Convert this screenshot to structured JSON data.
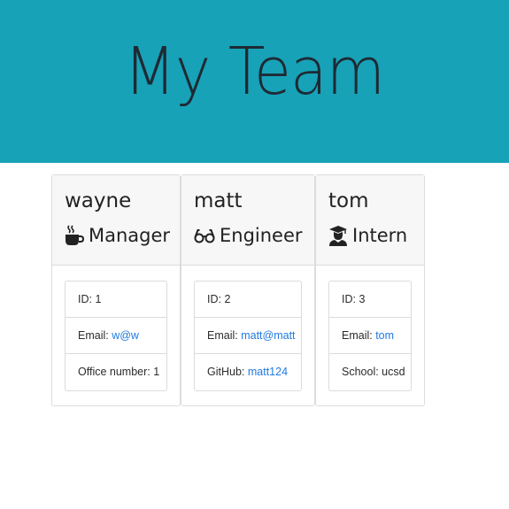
{
  "header": {
    "title": "My Team"
  },
  "members": [
    {
      "name": "wayne",
      "role": "Manager",
      "role_icon": "coffee-icon",
      "id_label": "ID: 1",
      "email_prefix": "Email: ",
      "email_link": "w@w",
      "extra_prefix": "Office number: 1",
      "extra_link": ""
    },
    {
      "name": "matt",
      "role": "Engineer",
      "role_icon": "glasses-icon",
      "id_label": "ID: 2",
      "email_prefix": "Email: ",
      "email_link": "matt@matt",
      "extra_prefix": "GitHub: ",
      "extra_link": "matt124"
    },
    {
      "name": "tom",
      "role": "Intern",
      "role_icon": "graduate-icon",
      "id_label": "ID: 3",
      "email_prefix": "Email: ",
      "email_link": "tom",
      "extra_prefix": "School: ucsd",
      "extra_link": ""
    }
  ],
  "colors": {
    "header_bg": "#17a2b8",
    "link": "#1f7ae0",
    "card_header_bg": "#f7f7f7"
  }
}
